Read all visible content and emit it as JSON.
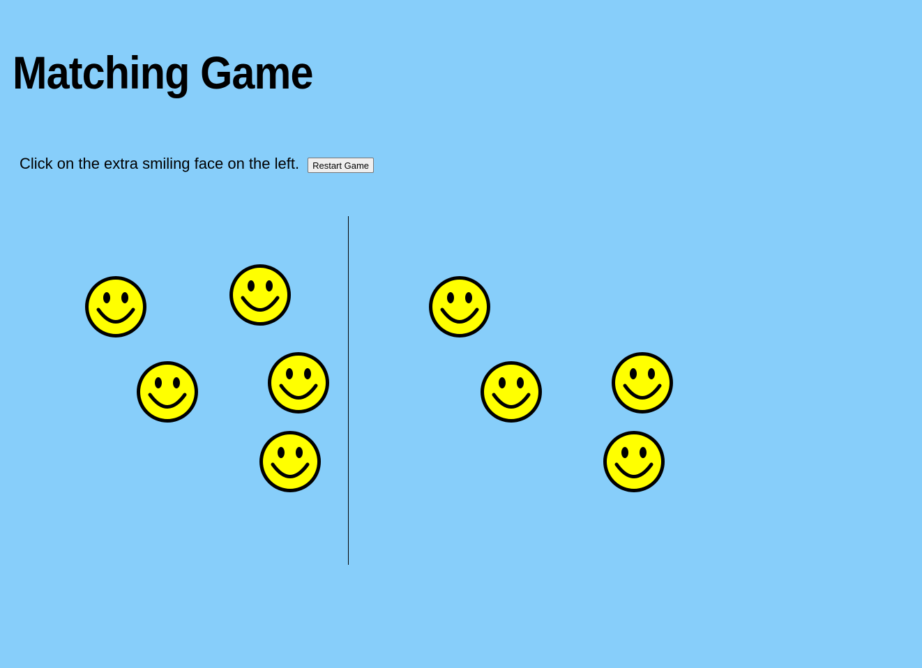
{
  "header": {
    "title": "Matching Game"
  },
  "controls": {
    "instruction": "Click on the extra smiling face on the left.",
    "restart_label": "Restart Game"
  },
  "colors": {
    "background": "#87CEFA",
    "face_fill": "#FFFF00",
    "face_stroke": "#000000"
  },
  "icons": {
    "face": "smiley-face-icon"
  },
  "boards": {
    "left": {
      "face_count": 5
    },
    "right": {
      "face_count": 4
    }
  }
}
